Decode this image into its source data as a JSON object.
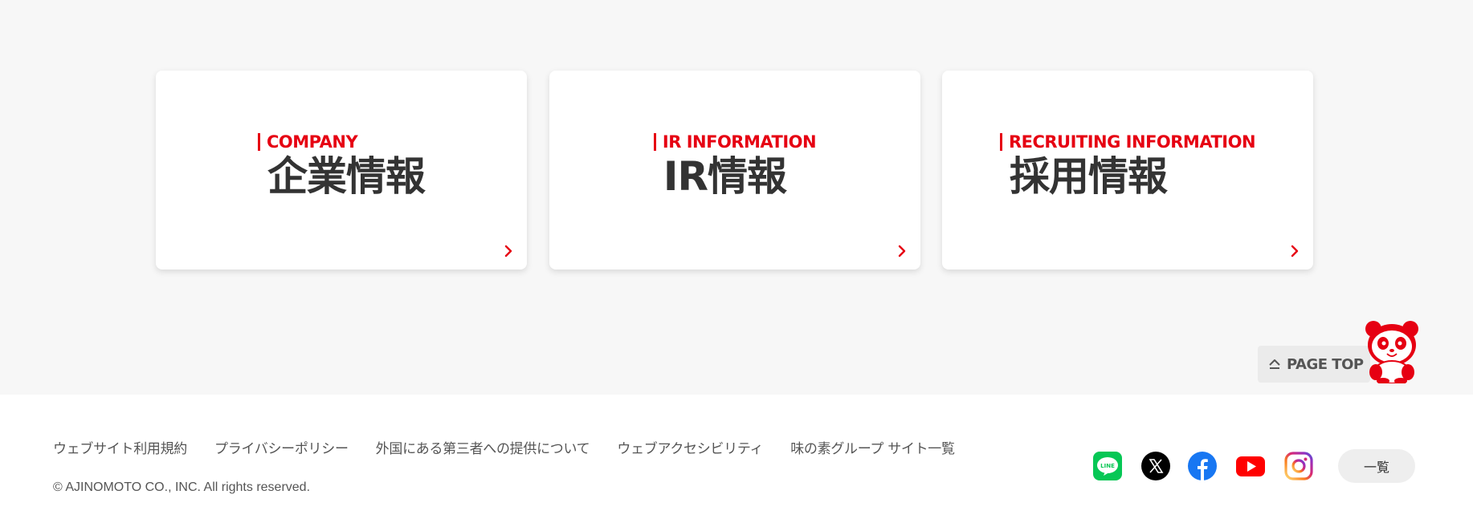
{
  "cards": [
    {
      "en": "COMPANY",
      "jp": "企業情報"
    },
    {
      "en": "IR INFORMATION",
      "jp": "IR情報"
    },
    {
      "en": "RECRUITING INFORMATION",
      "jp": "採用情報"
    }
  ],
  "page_top": {
    "label": "PAGE TOP",
    "icon": "arrow-up-icon"
  },
  "footer": {
    "links": [
      "ウェブサイト利用規約",
      "プライバシーポリシー",
      "外国にある第三者への提供について",
      "ウェブアクセシビリティ",
      "味の素グループ サイト一覧"
    ],
    "copyright": "© AJINOMOTO CO., INC. All rights reserved.",
    "social_icons": [
      "line-icon",
      "x-icon",
      "facebook-icon",
      "youtube-icon",
      "instagram-icon"
    ],
    "list_button": "一覧"
  },
  "colors": {
    "accent": "#e60012",
    "background": "#f7f7f7",
    "card": "#ffffff"
  }
}
